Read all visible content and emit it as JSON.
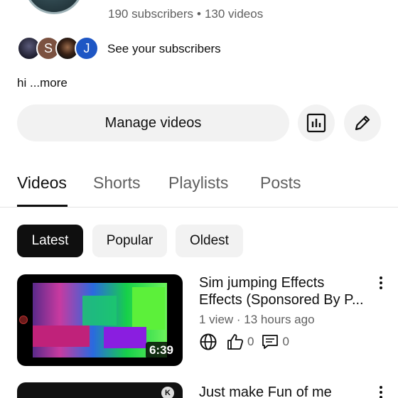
{
  "channel": {
    "stats": {
      "subscribers": "190 subscribers",
      "separator": "•",
      "videos": "130 videos"
    },
    "subscriber_avatars": [
      {
        "letter": ""
      },
      {
        "letter": "S"
      },
      {
        "letter": ""
      },
      {
        "letter": "J"
      }
    ],
    "see_subscribers": "See your subscribers",
    "description": {
      "text": "hi ",
      "more": "...more"
    }
  },
  "actions": {
    "manage_videos": "Manage videos",
    "analytics_icon": "bar-chart-icon",
    "edit_icon": "pencil-icon"
  },
  "tabs": [
    {
      "label": "Videos",
      "active": true
    },
    {
      "label": "Shorts",
      "active": false
    },
    {
      "label": "Playlists",
      "active": false
    },
    {
      "label": "Posts",
      "active": false
    }
  ],
  "chips": [
    {
      "label": "Latest",
      "active": true
    },
    {
      "label": "Popular",
      "active": false
    },
    {
      "label": "Oldest",
      "active": false
    }
  ],
  "videos": [
    {
      "title": "Sim jumping Effects Effects (Sponsored By P...",
      "duration": "6:39",
      "meta": "1 view · 13 hours ago",
      "likes": "0",
      "comments": "0"
    },
    {
      "title": "Just make Fun of me",
      "badge_letter": "K"
    }
  ],
  "colors": {
    "text_primary": "#0f0f0f",
    "text_secondary": "#606060",
    "chip_bg": "#f2f2f2",
    "chip_active_bg": "#0f0f0f",
    "avatar_j": "#1e56c4"
  }
}
